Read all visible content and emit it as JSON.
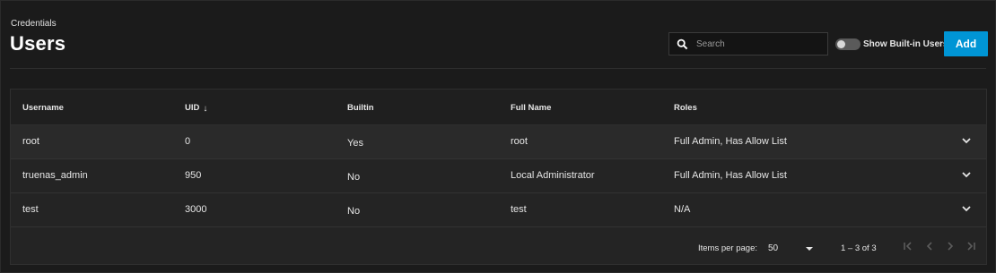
{
  "header": {
    "breadcrumb": "Credentials",
    "title": "Users",
    "search_placeholder": "Search",
    "toggle_label": "Show Built-in Users",
    "add_label": "Add"
  },
  "table": {
    "columns": [
      "Username",
      "UID",
      "Builtin",
      "Full Name",
      "Roles"
    ],
    "sort_column": "UID",
    "rows": [
      {
        "username": "root",
        "uid": "0",
        "builtin": "Yes",
        "full_name": "root",
        "roles": "Full Admin, Has Allow List"
      },
      {
        "username": "truenas_admin",
        "uid": "950",
        "builtin": "No",
        "full_name": "Local Administrator",
        "roles": "Full Admin, Has Allow List"
      },
      {
        "username": "test",
        "uid": "3000",
        "builtin": "No",
        "full_name": "test",
        "roles": "N/A"
      }
    ]
  },
  "paginator": {
    "items_per_page_label": "Items per page:",
    "items_per_page_value": "50",
    "range_label": "1 – 3 of 3"
  },
  "icons": [
    "search-icon",
    "sort-down-icon",
    "chevron-down-icon",
    "first-page-icon",
    "prev-page-icon",
    "next-page-icon",
    "last-page-icon"
  ],
  "colors": {
    "accent": "#0095d5",
    "background": "#1b1b1b",
    "table": "#242424"
  },
  "toggle_state": false
}
